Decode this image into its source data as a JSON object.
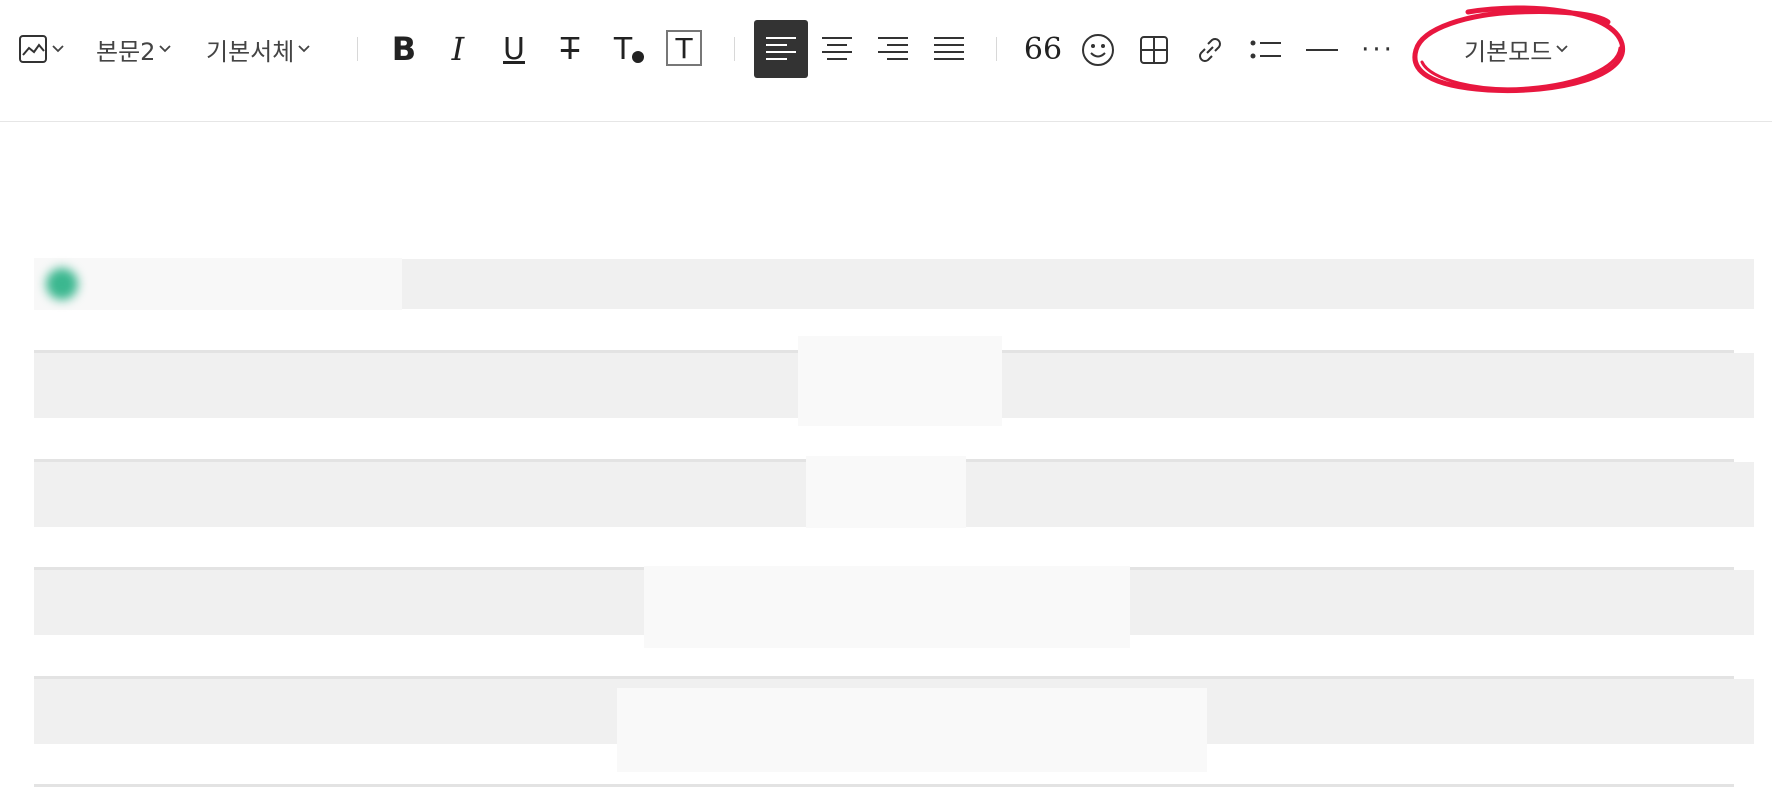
{
  "toolbar": {
    "paragraph_style": "본문2",
    "font_family": "기본서체",
    "mode": "기본모드",
    "buttons": {
      "image": "image-icon",
      "bold": "B",
      "italic": "I",
      "underline": "U",
      "strikethrough": "T",
      "text_color": "T",
      "text_background": "T",
      "align_left": "align-left-icon",
      "align_center": "align-center-icon",
      "align_right": "align-right-icon",
      "align_justify": "align-justify-icon",
      "quote": "66",
      "emoji": "emoji-icon",
      "table": "table-icon",
      "link": "link-icon",
      "list": "list-icon",
      "divider": "divider-icon",
      "more": "···"
    },
    "active_alignment": "left",
    "highlight_color": "#e8173f",
    "active_color": "#333333"
  },
  "document": {
    "header_chip": "",
    "rows": [
      "",
      "",
      "",
      ""
    ]
  }
}
